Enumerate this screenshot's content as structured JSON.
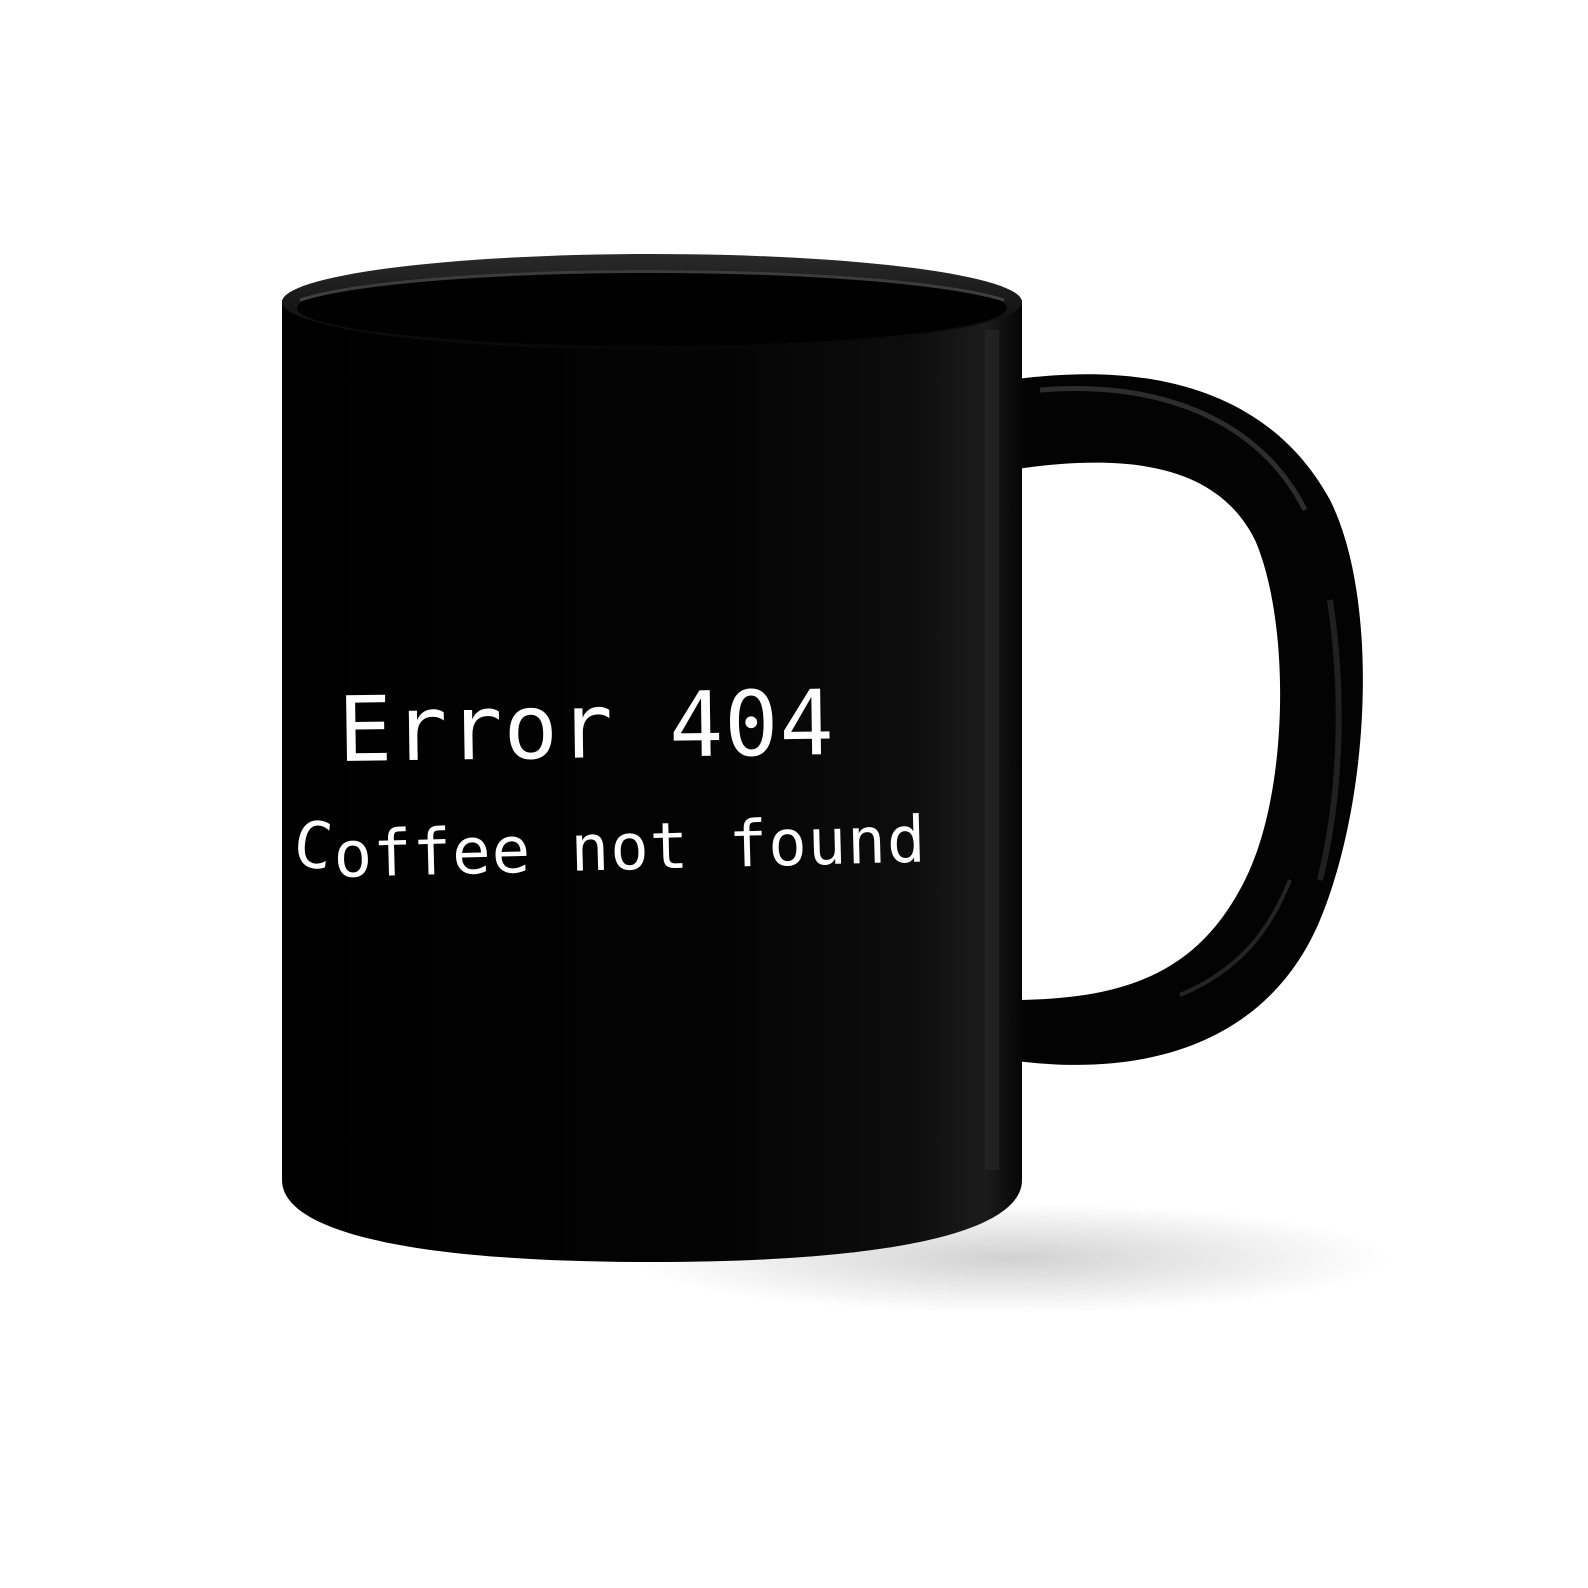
{
  "product": {
    "type": "black ceramic mug",
    "colors": {
      "background": "#ffffff",
      "mug_body": "#050505",
      "print": "#ffffff"
    },
    "print_text": {
      "line1": "Error 404",
      "line2_first": "C",
      "line2_rest": "offee not found"
    }
  }
}
